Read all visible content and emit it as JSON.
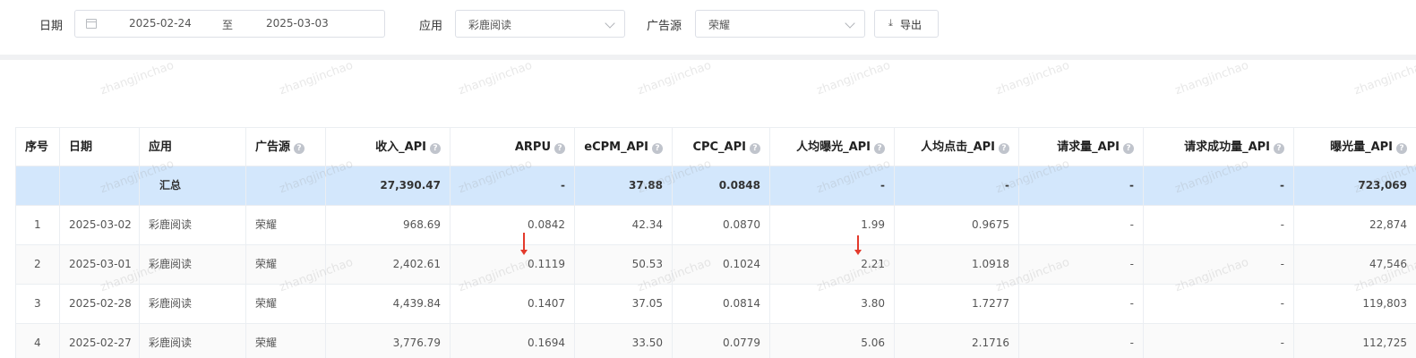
{
  "filters": {
    "date_label": "日期",
    "date_start": "2025-02-24",
    "date_sep": "至",
    "date_end": "2025-03-03",
    "app_label": "应用",
    "app_value": "彩鹿阅读",
    "source_label": "广告源",
    "source_value": "荣耀",
    "export_label": "导出",
    "export_icon": "download-icon"
  },
  "watermark": "zhangjinchao",
  "table": {
    "columns": [
      "序号",
      "日期",
      "应用",
      "广告源",
      "收入_API",
      "ARPU",
      "eCPM_API",
      "CPC_API",
      "人均曝光_API",
      "人均点击_API",
      "请求量_API",
      "请求成功量_API",
      "曝光量_API"
    ],
    "summary": {
      "label": "汇总",
      "values": [
        "27,390.47",
        "-",
        "37.88",
        "0.0848",
        "-",
        "-",
        "-",
        "-",
        "723,069"
      ]
    },
    "rows": [
      {
        "cells": [
          "1",
          "2025-03-02",
          "彩鹿阅读",
          "荣耀",
          "968.69",
          "0.0842",
          "42.34",
          "0.0870",
          "1.99",
          "0.9675",
          "-",
          "-",
          "22,874"
        ]
      },
      {
        "cells": [
          "2",
          "2025-03-01",
          "彩鹿阅读",
          "荣耀",
          "2,402.61",
          "0.1119",
          "50.53",
          "0.1024",
          "2.21",
          "1.0918",
          "-",
          "-",
          "47,546"
        ]
      },
      {
        "cells": [
          "3",
          "2025-02-28",
          "彩鹿阅读",
          "荣耀",
          "4,439.84",
          "0.1407",
          "37.05",
          "0.0814",
          "3.80",
          "1.7277",
          "-",
          "-",
          "119,803"
        ]
      },
      {
        "cells": [
          "4",
          "2025-02-27",
          "彩鹿阅读",
          "荣耀",
          "3,776.79",
          "0.1694",
          "33.50",
          "0.0779",
          "5.06",
          "2.1716",
          "-",
          "-",
          "112,725"
        ]
      }
    ]
  },
  "colors": {
    "summary_bg": "#d3e7fc",
    "annotation_arrow": "#e33a2c"
  }
}
